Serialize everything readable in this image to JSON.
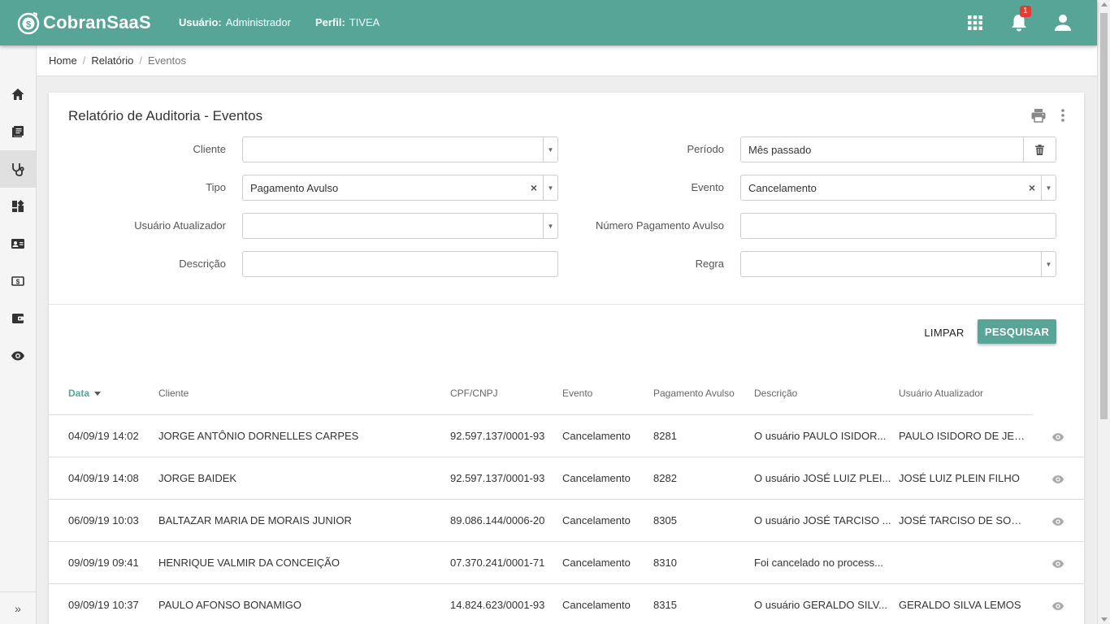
{
  "header": {
    "app_name": "CobranSaaS",
    "user_label": "Usuário:",
    "user_value": "Administrador",
    "profile_label": "Perfil:",
    "profile_value": "TIVEA",
    "notification_count": "1",
    "brand_color": "#57a597"
  },
  "breadcrumb": {
    "home": "Home",
    "report": "Relatório",
    "current": "Eventos",
    "separator": "/"
  },
  "sidebar": {
    "items": [
      "home-icon",
      "book-icon",
      "stethoscope-icon",
      "dashboard-icon",
      "contact-card-icon",
      "money-icon",
      "wallet-icon",
      "eye-icon"
    ],
    "expand": "»"
  },
  "card": {
    "title": "Relatório de Auditoria - Eventos"
  },
  "filters": {
    "cliente": {
      "label": "Cliente",
      "value": ""
    },
    "periodo": {
      "label": "Período",
      "value": "Mês passado"
    },
    "tipo": {
      "label": "Tipo",
      "value": "Pagamento Avulso"
    },
    "evento": {
      "label": "Evento",
      "value": "Cancelamento"
    },
    "usuario": {
      "label": "Usuário Atualizador",
      "value": ""
    },
    "numero": {
      "label": "Número Pagamento Avulso",
      "value": ""
    },
    "descricao": {
      "label": "Descrição",
      "value": ""
    },
    "regra": {
      "label": "Regra",
      "value": ""
    },
    "clear_glyph": "×",
    "caret_glyph": "▼"
  },
  "actions": {
    "clear": "LIMPAR",
    "search": "PESQUISAR"
  },
  "table": {
    "columns": {
      "data": "Data",
      "cliente": "Cliente",
      "cpf": "CPF/CNPJ",
      "evento": "Evento",
      "pagamento": "Pagamento Avulso",
      "descricao": "Descrição",
      "usuario": "Usuário Atualizador"
    },
    "rows": [
      {
        "data": "04/09/19 14:02",
        "cliente": "JORGE ANTÔNIO DORNELLES CARPES",
        "cpf": "92.597.137/0001-93",
        "evento": "Cancelamento",
        "pagamento": "8281",
        "descricao": "O usuário PAULO ISIDOR...",
        "usuario": "PAULO ISIDORO DE JESUS"
      },
      {
        "data": "04/09/19 14:08",
        "cliente": "JORGE BAIDEK",
        "cpf": "92.597.137/0001-93",
        "evento": "Cancelamento",
        "pagamento": "8282",
        "descricao": "O usuário JOSÉ LUIZ PLEI...",
        "usuario": "JOSÉ LUIZ PLEIN FILHO"
      },
      {
        "data": "06/09/19 10:03",
        "cliente": "BALTAZAR MARIA DE MORAIS JUNIOR",
        "cpf": "89.086.144/0006-20",
        "evento": "Cancelamento",
        "pagamento": "8305",
        "descricao": "O usuário JOSÉ TARCISO ...",
        "usuario": "JOSÉ TARCISO DE SOUZA"
      },
      {
        "data": "09/09/19 09:41",
        "cliente": "HENRIQUE VALMIR DA CONCEIÇÃO",
        "cpf": "07.370.241/0001-71",
        "evento": "Cancelamento",
        "pagamento": "8310",
        "descricao": "Foi cancelado no process...",
        "usuario": ""
      },
      {
        "data": "09/09/19 10:37",
        "cliente": "PAULO AFONSO BONAMIGO",
        "cpf": "14.824.623/0001-93",
        "evento": "Cancelamento",
        "pagamento": "8315",
        "descricao": "O usuário GERALDO SILV...",
        "usuario": "GERALDO SILVA LEMOS"
      }
    ]
  }
}
